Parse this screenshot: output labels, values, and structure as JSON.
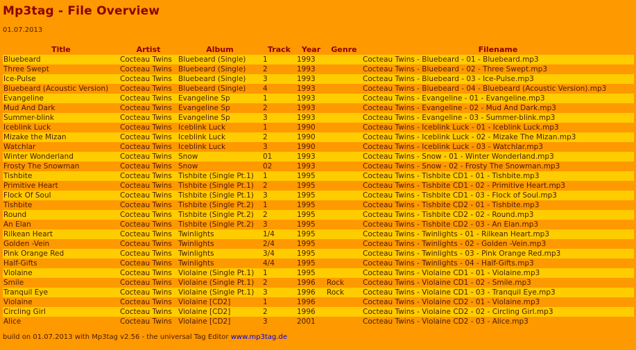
{
  "page": {
    "title": "Mp3tag - File Overview",
    "date": "01.07.2013"
  },
  "table": {
    "headers": [
      "Title",
      "Artist",
      "Album",
      "Track",
      "Year",
      "Genre",
      "Filename"
    ],
    "rows": [
      [
        "Bluebeard",
        "Cocteau Twins",
        "Bluebeard (Single)",
        "1",
        "1993",
        "",
        "Cocteau Twins - Bluebeard - 01 - Bluebeard.mp3"
      ],
      [
        "Three Swept",
        "Cocteau Twins",
        "Bluebeard (Single)",
        "2",
        "1993",
        "",
        "Cocteau Twins - Bluebeard - 02 - Three Swept.mp3"
      ],
      [
        "Ice-Pulse",
        "Cocteau Twins",
        "Bluebeard (Single)",
        "3",
        "1993",
        "",
        "Cocteau Twins - Bluebeard - 03 - Ice-Pulse.mp3"
      ],
      [
        "Bluebeard (Acoustic Version)",
        "Cocteau Twins",
        "Bluebeard (Single)",
        "4",
        "1993",
        "",
        "Cocteau Twins - Bluebeard - 04 - Bluebeard (Acoustic Version).mp3"
      ],
      [
        "Evangeline",
        "Cocteau Twins",
        "Evangeline Sp",
        "1",
        "1993",
        "",
        "Cocteau Twins - Evangeline - 01 - Evangeline.mp3"
      ],
      [
        "Mud And Dark",
        "Cocteau Twins",
        "Evangeline Sp",
        "2",
        "1993",
        "",
        "Cocteau Twins - Evangeline - 02 - Mud And Dark.mp3"
      ],
      [
        "Summer-blink",
        "Cocteau Twins",
        "Evangeline Sp",
        "3",
        "1993",
        "",
        "Cocteau Twins - Evangeline - 03 - Summer-blink.mp3"
      ],
      [
        "Iceblink Luck",
        "Cocteau Twins",
        "Iceblink Luck",
        "1",
        "1990",
        "",
        "Cocteau Twins - Iceblink Luck - 01 - Iceblink Luck.mp3"
      ],
      [
        "Mizake the Mizan",
        "Cocteau Twins",
        "Iceblink Luck",
        "2",
        "1990",
        "",
        "Cocteau Twins - Iceblink Luck - 02 - Mizake The Mizan.mp3"
      ],
      [
        "Watchlar",
        "Cocteau Twins",
        "Iceblink Luck",
        "3",
        "1990",
        "",
        "Cocteau Twins - Iceblink Luck - 03 - Watchlar.mp3"
      ],
      [
        "Winter Wonderland",
        "Cocteau Twins",
        "Snow",
        "01",
        "1993",
        "",
        "Cocteau Twins - Snow - 01 - Winter Wonderland.mp3"
      ],
      [
        "Frosty The Snowman",
        "Cocteau Twins",
        "Snow",
        "02",
        "1993",
        "",
        "Cocteau Twins - Snow - 02 - Frosty The Snowman.mp3"
      ],
      [
        "Tishbite",
        "Cocteau Twins",
        "Tishbite (Single Pt.1)",
        "1",
        "1995",
        "",
        "Cocteau Twins - Tishbite CD1 - 01 - Tishbite.mp3"
      ],
      [
        "Primitive Heart",
        "Cocteau Twins",
        "Tishbite (Single Pt.1)",
        "2",
        "1995",
        "",
        "Cocteau Twins - Tishbite CD1 - 02 - Primitive Heart.mp3"
      ],
      [
        "Flock Of Soul",
        "Cocteau Twins",
        "Tishbite (Single Pt.1)",
        "3",
        "1995",
        "",
        "Cocteau Twins - Tishbite CD1 - 03 - Flock of Soul.mp3"
      ],
      [
        "Tishbite",
        "Cocteau Twins",
        "Tishbite (Single Pt.2)",
        "1",
        "1995",
        "",
        "Cocteau Twins - Tishbite CD2 - 01 - Tishbite.mp3"
      ],
      [
        "Round",
        "Cocteau Twins",
        "Tishbite (Single Pt.2)",
        "2",
        "1995",
        "",
        "Cocteau Twins - Tishbite CD2 - 02 - Round.mp3"
      ],
      [
        "An Elan",
        "Cocteau Twins",
        "Tishbite (Single Pt.2)",
        "3",
        "1995",
        "",
        "Cocteau Twins - Tishbite CD2 - 03 - An Elan.mp3"
      ],
      [
        "Rilkean Heart",
        "Cocteau Twins",
        "Twinlights",
        "1/4",
        "1995",
        "",
        "Cocteau Twins - Twinlights - 01 - Rilkean Heart.mp3"
      ],
      [
        "Golden -Vein",
        "Cocteau Twins",
        "Twinlights",
        "2/4",
        "1995",
        "",
        "Cocteau Twins - Twinlights - 02 - Golden -Vein.mp3"
      ],
      [
        "Pink Orange Red",
        "Cocteau Twins",
        "Twinlights",
        "3/4",
        "1995",
        "",
        "Cocteau Twins - Twinlights - 03 - Pink Orange Red.mp3"
      ],
      [
        "Half-Gifts",
        "Cocteau Twins",
        "Twinlights",
        "4/4",
        "1995",
        "",
        "Cocteau Twins - Twinlights - 04 - Half-Gifts.mp3"
      ],
      [
        "Violaine",
        "Cocteau Twins",
        "Violaine (Single Pt.1)",
        "1",
        "1995",
        "",
        "Cocteau Twins - Violaine CD1 - 01 - Violaine.mp3"
      ],
      [
        "Smile",
        "Cocteau Twins",
        "Violaine (Single Pt.1)",
        "2",
        "1996",
        "Rock",
        "Cocteau Twins - Violaine CD1 - 02 - Smile.mp3"
      ],
      [
        "Tranquil Eye",
        "Cocteau Twins",
        "Violaine (Single Pt.1)",
        "3",
        "1996",
        "Rock",
        "Cocteau Twins - Violaine CD1 - 03 - Tranquil Eye.mp3"
      ],
      [
        "Violaine",
        "Cocteau Twins",
        "Violaine [CD2]",
        "1",
        "1996",
        "",
        "Cocteau Twins - Violaine CD2 - 01 - Violaine.mp3"
      ],
      [
        "Circling Girl",
        "Cocteau Twins",
        "Violaine [CD2]",
        "2",
        "1996",
        "",
        "Cocteau Twins - Violaine CD2 - 02 - Circling Girl.mp3"
      ],
      [
        "Alice",
        "Cocteau Twins",
        "Violaine [CD2]",
        "3",
        "2001",
        "",
        "Cocteau Twins - Violaine CD2 - 03 - Alice.mp3"
      ]
    ]
  },
  "footer": {
    "text": "build on 01.07.2013 with Mp3tag v2.56 - the universal Tag Editor",
    "link_text": "www.mp3tag.de"
  },
  "colors": {
    "background": "#ff9900",
    "row_highlight": "#ffcc00",
    "title": "#8b0000",
    "link": "#0000ee"
  }
}
